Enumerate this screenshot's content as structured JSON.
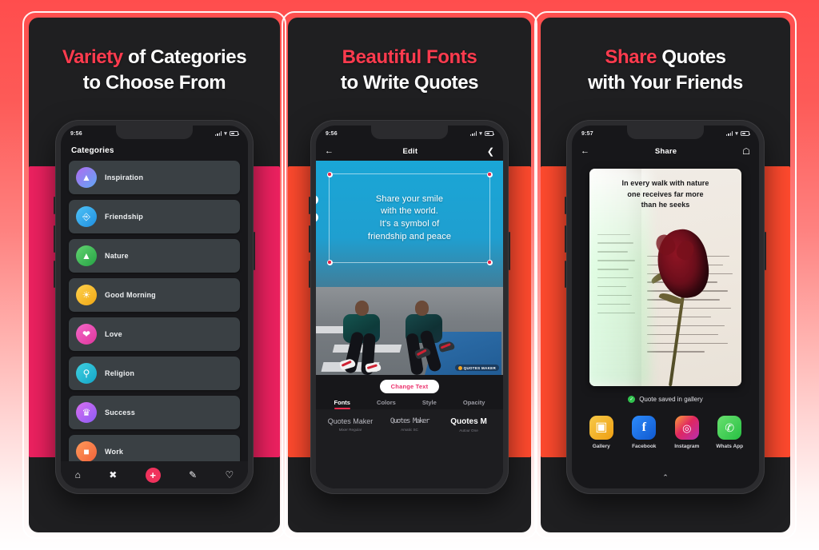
{
  "theme": {
    "bg_top": "#ff4d4d",
    "bg_bottom": "#ffffff",
    "accent_pink": "#ed2160",
    "accent_orange": "#ff4a2e",
    "highlight": "#ff3b4e"
  },
  "panels": [
    {
      "headline_highlight": "Variety",
      "headline_rest": " of Categories",
      "headline_line2": "to Choose From",
      "status": {
        "time": "9:56"
      },
      "screen_title": "Categories",
      "categories": [
        {
          "label": "Inspiration",
          "icon": "mountain-icon",
          "glyph": "⛰",
          "c1": "#b06bf0",
          "c2": "#5fa8f5"
        },
        {
          "label": "Friendship",
          "icon": "handshake-icon",
          "glyph": "🤝",
          "c1": "#4fc3f7",
          "c2": "#1f8fe0"
        },
        {
          "label": "Nature",
          "icon": "tree-icon",
          "glyph": "🌲",
          "c1": "#63d471",
          "c2": "#25a244"
        },
        {
          "label": "Good Morning",
          "icon": "sun-icon",
          "glyph": "☀",
          "c1": "#ffd24d",
          "c2": "#f0a714"
        },
        {
          "label": "Love",
          "icon": "heart-icon",
          "glyph": "❤",
          "c1": "#f368c8",
          "c2": "#e0359c"
        },
        {
          "label": "Religion",
          "icon": "praying-hands-icon",
          "glyph": "🙏",
          "c1": "#3fd0e0",
          "c2": "#14a6c8"
        },
        {
          "label": "Success",
          "icon": "trophy-icon",
          "glyph": "🏆",
          "c1": "#d96ef0",
          "c2": "#8b5cf6"
        },
        {
          "label": "Work",
          "icon": "briefcase-icon",
          "glyph": "💼",
          "c1": "#ff9a5a",
          "c2": "#f2623a"
        }
      ],
      "tabbar": [
        {
          "name": "home",
          "glyph": "⌂"
        },
        {
          "name": "shuffle",
          "glyph": "✖"
        },
        {
          "name": "add",
          "glyph": "+"
        },
        {
          "name": "edit",
          "glyph": "✎"
        },
        {
          "name": "favorites",
          "glyph": "♡"
        }
      ]
    },
    {
      "headline_highlight": "Beautiful Fonts",
      "headline_rest": "",
      "headline_line2": "to Write Quotes",
      "status": {
        "time": "9:56"
      },
      "appbar": {
        "back": "←",
        "title": "Edit",
        "action": "share-icon"
      },
      "quote": "Share your smile\nwith the world.\nIt's a symbol of\nfriendship and peace",
      "watermark": "QUOTES MAKER",
      "change_text": "Change Text",
      "tabs": [
        {
          "label": "Fonts",
          "active": true
        },
        {
          "label": "Colors",
          "active": false
        },
        {
          "label": "Style",
          "active": false
        },
        {
          "label": "Opacity",
          "active": false
        }
      ],
      "fonts": [
        {
          "preview": "Quotes Maker",
          "name": "Mixer Regular"
        },
        {
          "preview": "Quotes Maker",
          "name": "Amatic SC"
        },
        {
          "preview": "Quotes M",
          "name": "Autour One"
        }
      ]
    },
    {
      "headline_highlight": "Share",
      "headline_rest": " Quotes",
      "headline_line2": "with Your Friends",
      "status": {
        "time": "9:57"
      },
      "appbar": {
        "back": "←",
        "title": "Share",
        "action": "home-icon"
      },
      "quote": "In every walk with nature\none receives far more\nthan he seeks",
      "saved_text": "Quote saved in gallery",
      "apps": [
        {
          "label": "Gallery",
          "icon": "gallery-icon",
          "glyph": "🖼",
          "bg": "#f5b618"
        },
        {
          "label": "Facebook",
          "icon": "facebook-icon",
          "glyph": "f",
          "bg": "#1877f2"
        },
        {
          "label": "Instagram",
          "icon": "instagram-icon",
          "glyph": "◎",
          "bg": "#e1306c"
        },
        {
          "label": "Whats App",
          "icon": "whatsapp-icon",
          "glyph": "✆",
          "bg": "#4ed95f"
        }
      ],
      "expand": "⌃"
    }
  ]
}
